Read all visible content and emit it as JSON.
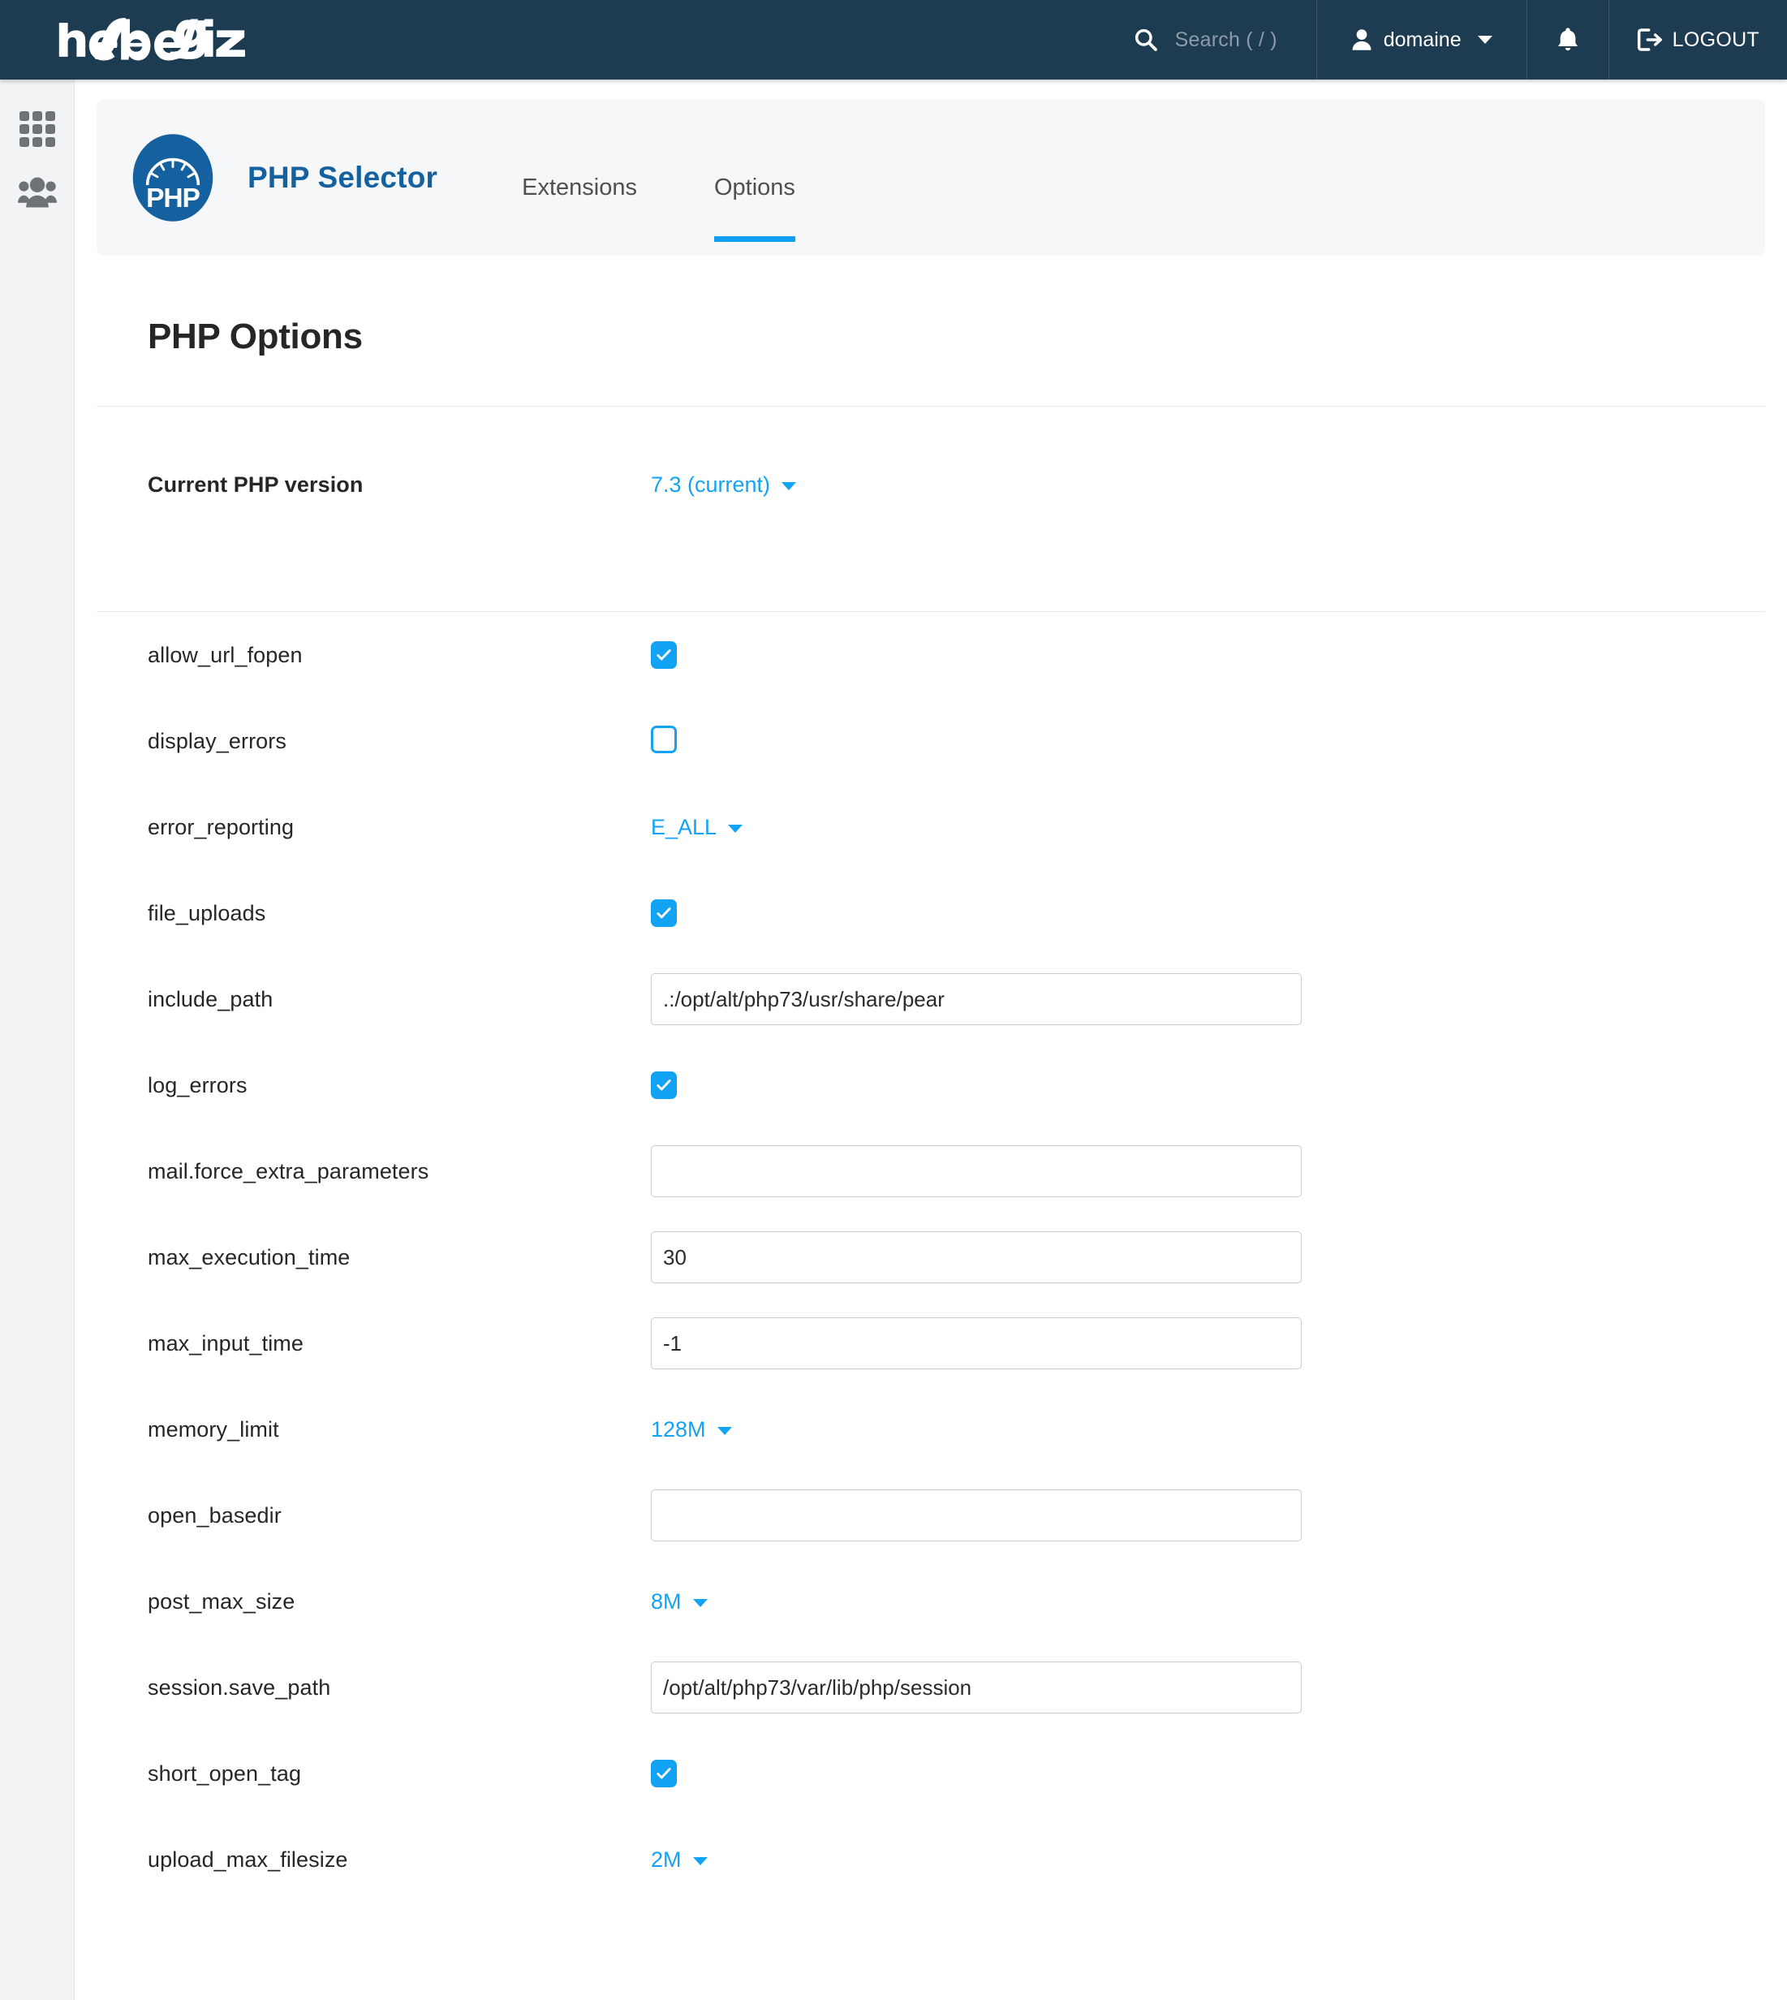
{
  "topbar": {
    "logo_text": "hebergahiz",
    "search": {
      "placeholder": "Search ( / )",
      "icon": "search-icon"
    },
    "user": {
      "name": "domaine",
      "icon": "user-icon",
      "caret": "chevron-down-icon"
    },
    "notifications": {
      "icon": "bell-icon"
    },
    "logout": {
      "label": "LOGOUT",
      "icon": "logout-icon"
    }
  },
  "sidebar": {
    "items": [
      {
        "name": "apps-grid",
        "icon": "grid-icon"
      },
      {
        "name": "users",
        "icon": "users-icon"
      }
    ]
  },
  "app_header": {
    "logo_text": "PHP",
    "title": "PHP Selector",
    "tabs": [
      {
        "label": "Extensions",
        "active": false
      },
      {
        "label": "Options",
        "active": true
      }
    ],
    "active_underline_color": "#0f9ff2"
  },
  "page": {
    "title": "PHP Options",
    "version_row": {
      "label": "Current PHP version",
      "value": "7.3 (current)",
      "type": "select"
    }
  },
  "options": [
    {
      "label": "allow_url_fopen",
      "type": "checkbox",
      "checked": true
    },
    {
      "label": "display_errors",
      "type": "checkbox",
      "checked": false
    },
    {
      "label": "error_reporting",
      "type": "select",
      "value": "E_ALL"
    },
    {
      "label": "file_uploads",
      "type": "checkbox",
      "checked": true
    },
    {
      "label": "include_path",
      "type": "text",
      "value": ".:/opt/alt/php73/usr/share/pear"
    },
    {
      "label": "log_errors",
      "type": "checkbox",
      "checked": true
    },
    {
      "label": "mail.force_extra_parameters",
      "type": "text",
      "value": ""
    },
    {
      "label": "max_execution_time",
      "type": "text",
      "value": "30"
    },
    {
      "label": "max_input_time",
      "type": "text",
      "value": "-1"
    },
    {
      "label": "memory_limit",
      "type": "select",
      "value": "128M"
    },
    {
      "label": "open_basedir",
      "type": "text",
      "value": ""
    },
    {
      "label": "post_max_size",
      "type": "select",
      "value": "8M"
    },
    {
      "label": "session.save_path",
      "type": "text",
      "value": "/opt/alt/php73/var/lib/php/session"
    },
    {
      "label": "short_open_tag",
      "type": "checkbox",
      "checked": true
    },
    {
      "label": "upload_max_filesize",
      "type": "select",
      "value": "2M"
    }
  ],
  "colors": {
    "topbar_bg": "#1d3b51",
    "accent_blue": "#12a3f5",
    "brand_blue": "#15609f",
    "card_bg": "#f5f7f9",
    "sidebar_bg": "#f2f3f4"
  }
}
